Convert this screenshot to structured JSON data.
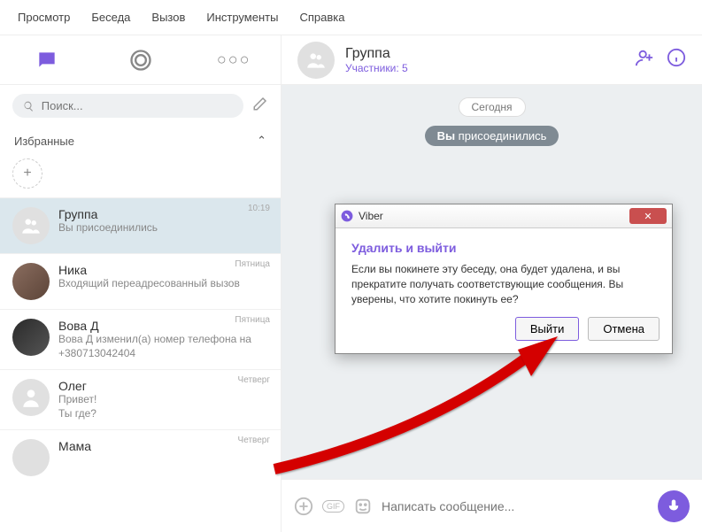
{
  "menu": {
    "view": "Просмотр",
    "chat": "Беседа",
    "call": "Вызов",
    "tools": "Инструменты",
    "help": "Справка"
  },
  "search": {
    "placeholder": "Поиск..."
  },
  "favorites": {
    "title": "Избранные"
  },
  "chats": [
    {
      "name": "Группа",
      "preview": "Вы присоединились",
      "time": "10:19"
    },
    {
      "name": "Ника",
      "preview": "Входящий переадресованный вызов",
      "time": "Пятница"
    },
    {
      "name": "Вова Д",
      "preview": "Вова Д изменил(а) номер телефона на +380713042404",
      "time": "Пятница"
    },
    {
      "name": "Олег",
      "preview": "Привет!\nТы где?",
      "time": "Четверг"
    },
    {
      "name": "Мама",
      "preview": "",
      "time": "Четверг"
    }
  ],
  "header": {
    "title": "Группа",
    "subtitle": "Участники: 5"
  },
  "stream": {
    "date": "Сегодня",
    "joined_bold": "Вы",
    "joined_rest": " присоединились"
  },
  "input": {
    "placeholder": "Написать сообщение..."
  },
  "dialog": {
    "app": "Viber",
    "title": "Удалить и выйти",
    "body": "Если вы покинете эту беседу, она будет удалена, и вы прекратите получать соответствующие сообщения. Вы уверены, что хотите покинуть ее?",
    "confirm": "Выйти",
    "cancel": "Отмена"
  }
}
